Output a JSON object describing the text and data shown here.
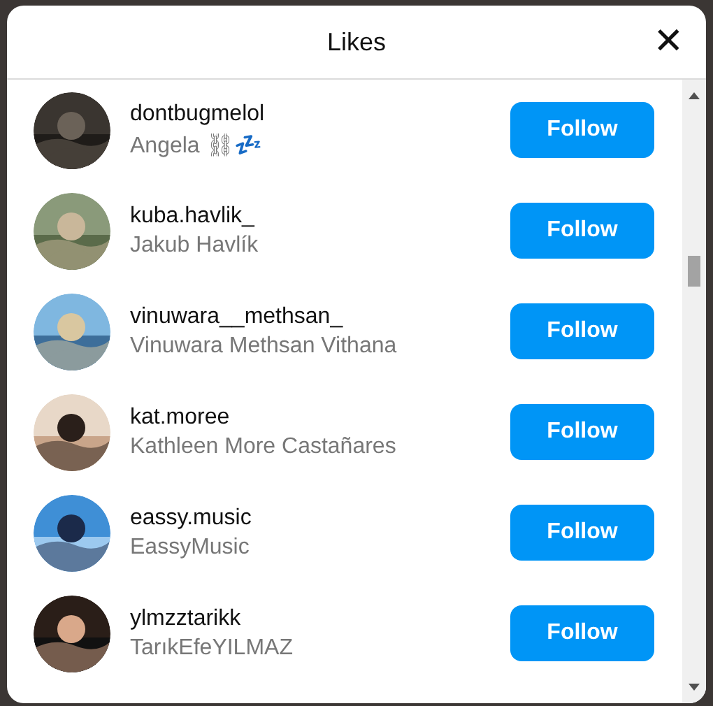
{
  "dialog": {
    "title": "Likes",
    "close": "✕"
  },
  "users": [
    {
      "username": "dontbugmelol",
      "name": "Angela ⛓💤",
      "button": "Follow"
    },
    {
      "username": "kuba.havlik_",
      "name": "Jakub Havlík",
      "button": "Follow"
    },
    {
      "username": "vinuwara__methsan_",
      "name": "Vinuwara Methsan Vithana",
      "button": "Follow"
    },
    {
      "username": "kat.moree",
      "name": "Kathleen More Castañares",
      "button": "Follow"
    },
    {
      "username": "eassy.music",
      "name": "EassyMusic",
      "button": "Follow"
    },
    {
      "username": "ylmzztarikk",
      "name": "TarıkEfeYILMAZ",
      "button": "Follow"
    }
  ]
}
